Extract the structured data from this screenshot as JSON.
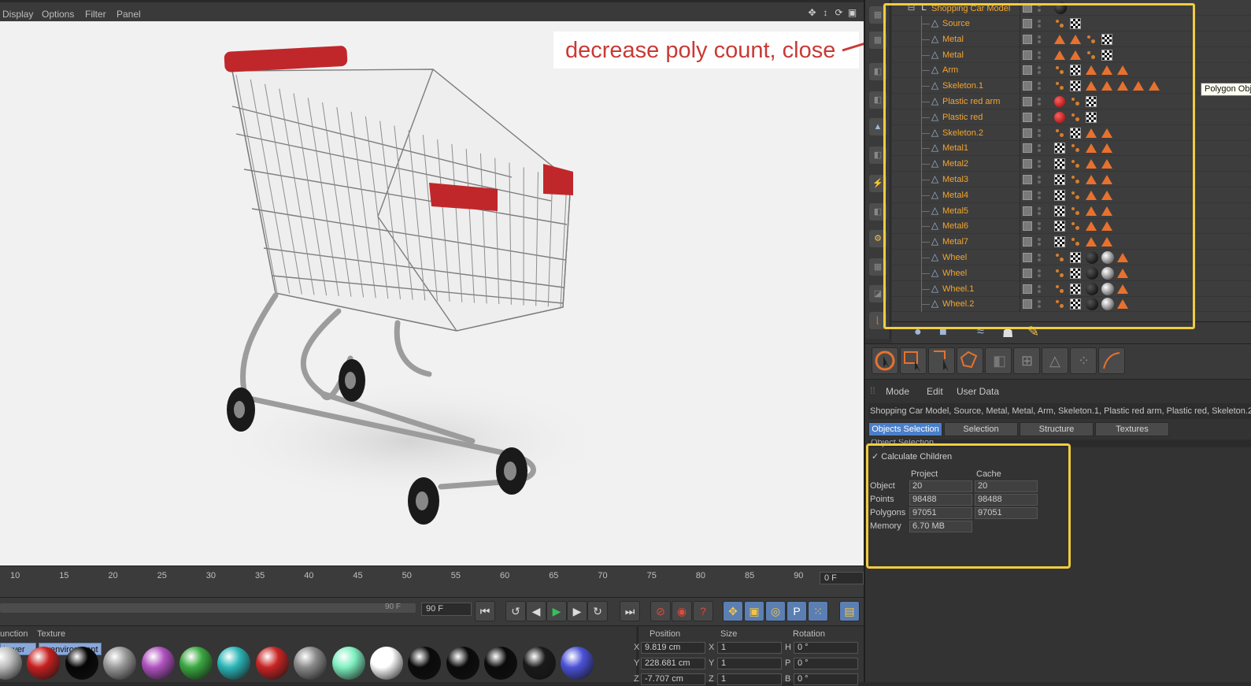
{
  "viewport": {
    "menu": [
      "Display",
      "Options",
      "Filter",
      "Panel"
    ],
    "annotation": "decrease poly count, close"
  },
  "timeline": {
    "ticks": [
      "10",
      "15",
      "20",
      "25",
      "30",
      "35",
      "40",
      "45",
      "50",
      "55",
      "60",
      "65",
      "70",
      "75",
      "80",
      "85",
      "90"
    ],
    "current_frame": "0 F",
    "range_end_label": "90 F",
    "end_frame_field": "90 F"
  },
  "materials": {
    "menu": [
      "unction",
      "Texture"
    ],
    "filters": [
      "Layer",
      "cyenvironment"
    ],
    "swatch_colors": [
      "#bdbdbd",
      "#c62020",
      "#050505",
      "#9a9a9a",
      "#b052c0",
      "#3aa840",
      "#2cb6b8",
      "#c82424",
      "#8a8a8a",
      "#7ef0c0",
      "#ffffff",
      "#0a0a0a",
      "#0a0a0a",
      "#0a0a0a",
      "#1a1a1a",
      "#4b52d8"
    ]
  },
  "coords": {
    "headers": [
      "Position",
      "Size",
      "Rotation"
    ],
    "rows": [
      {
        "axis": "X",
        "pos": "9.819 cm",
        "size_axis": "X",
        "size": "1",
        "rot_axis": "H",
        "rot": "0 °"
      },
      {
        "axis": "Y",
        "pos": "228.681 cm",
        "size_axis": "Y",
        "size": "1",
        "rot_axis": "P",
        "rot": "0 °"
      },
      {
        "axis": "Z",
        "pos": "-7.707 cm",
        "size_axis": "Z",
        "size": "1",
        "rot_axis": "B",
        "rot": "0 °"
      }
    ]
  },
  "objects": {
    "root": "Shopping Car Model",
    "tooltip": "Polygon Object",
    "items": [
      {
        "name": "Source",
        "tags": [
          "phong",
          "check"
        ]
      },
      {
        "name": "Metal",
        "tags": [
          "tri",
          "tri",
          "phong",
          "check"
        ]
      },
      {
        "name": "Metal",
        "tags": [
          "tri",
          "tri",
          "phong",
          "check"
        ]
      },
      {
        "name": "Arm",
        "tags": [
          "phong",
          "check",
          "tri",
          "tri",
          "tri"
        ]
      },
      {
        "name": "Skeleton.1",
        "tags": [
          "phong",
          "check",
          "tri",
          "tri",
          "tri",
          "tri",
          "tri"
        ]
      },
      {
        "name": "Plastic red arm",
        "tags": [
          "red",
          "phong",
          "check"
        ]
      },
      {
        "name": "Plastic red",
        "tags": [
          "red",
          "phong",
          "check"
        ]
      },
      {
        "name": "Skeleton.2",
        "tags": [
          "phong",
          "check",
          "tri",
          "tri"
        ]
      },
      {
        "name": "Metal1",
        "tags": [
          "check",
          "phong",
          "tri",
          "tri"
        ]
      },
      {
        "name": "Metal2",
        "tags": [
          "check",
          "phong",
          "tri",
          "tri"
        ]
      },
      {
        "name": "Metal3",
        "tags": [
          "check",
          "phong",
          "tri",
          "tri"
        ]
      },
      {
        "name": "Metal4",
        "tags": [
          "check",
          "phong",
          "tri",
          "tri"
        ]
      },
      {
        "name": "Metal5",
        "tags": [
          "check",
          "phong",
          "tri",
          "tri"
        ]
      },
      {
        "name": "Metal6",
        "tags": [
          "check",
          "phong",
          "tri",
          "tri"
        ]
      },
      {
        "name": "Metal7",
        "tags": [
          "check",
          "phong",
          "tri",
          "tri"
        ]
      },
      {
        "name": "Wheel",
        "tags": [
          "phong",
          "check",
          "black",
          "chrome",
          "tri"
        ]
      },
      {
        "name": "Wheel",
        "tags": [
          "phong",
          "check",
          "black",
          "chrome",
          "tri"
        ]
      },
      {
        "name": "Wheel.1",
        "tags": [
          "phong",
          "check",
          "black",
          "chrome",
          "tri"
        ]
      },
      {
        "name": "Wheel.2",
        "tags": [
          "phong",
          "check",
          "black",
          "chrome",
          "tri"
        ]
      }
    ]
  },
  "attributes": {
    "menu": [
      "Mode",
      "Edit",
      "User Data"
    ],
    "selected_objects": "Shopping Car Model, Source, Metal, Metal, Arm, Skeleton.1, Plastic red arm, Plastic red, Skeleton.2",
    "tabs": [
      "Objects Selection",
      "Selection",
      "Structure",
      "Textures"
    ],
    "section": "Object Selection",
    "calculate_children": "Calculate Children",
    "col_project": "Project",
    "col_cache": "Cache",
    "stats": [
      {
        "label": "Object",
        "project": "20",
        "cache": "20"
      },
      {
        "label": "Points",
        "project": "98488",
        "cache": "98488"
      },
      {
        "label": "Polygons",
        "project": "97051",
        "cache": "97051"
      },
      {
        "label": "Memory",
        "project": "6.70 MB",
        "cache": ""
      }
    ]
  },
  "colors": {
    "highlight": "#f0cd3e",
    "annotation_text": "#c83a35",
    "object_name": "#f2a531",
    "active_tab": "#4a7fc9"
  }
}
